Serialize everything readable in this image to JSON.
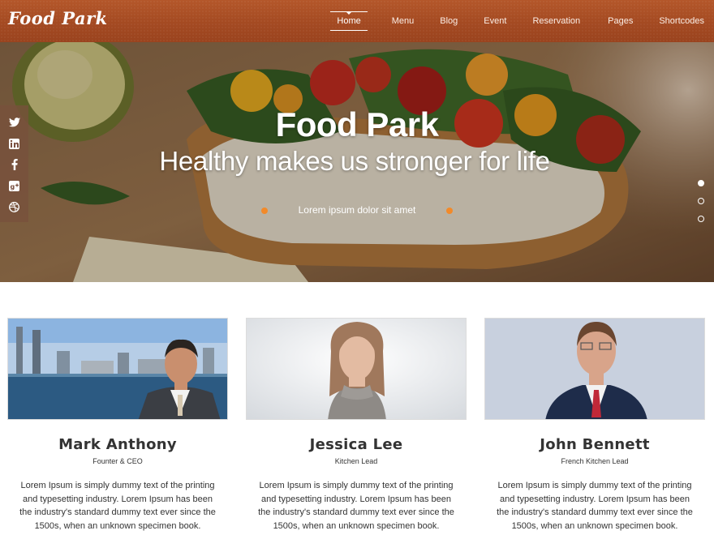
{
  "header": {
    "logo": "Food Park",
    "nav": [
      "Home",
      "Menu",
      "Blog",
      "Event",
      "Reservation",
      "Pages",
      "Shortcodes"
    ],
    "active_nav": "Home",
    "accent_color": "#a84d24"
  },
  "hero": {
    "title": "Food Park",
    "subtitle": "Healthy makes us stronger for life",
    "caption": "Lorem ipsum dolor sit amet",
    "accent_dot_color": "#f28a2a",
    "social_icons": [
      "twitter-icon",
      "linkedin-icon",
      "facebook-icon",
      "google-plus-icon",
      "dribbble-icon"
    ],
    "slides": 3,
    "active_slide": 1
  },
  "team": [
    {
      "name": "Mark Anthony",
      "role": "Founter & CEO",
      "text": "Lorem Ipsum is simply dummy text of the printing and typesetting industry. Lorem Ipsum has been the industry's standard dummy text ever since the 1500s, when an unknown  specimen book."
    },
    {
      "name": "Jessica Lee",
      "role": "Kitchen Lead",
      "text": "Lorem Ipsum is simply dummy text of the printing and typesetting industry. Lorem Ipsum has been the industry's standard dummy text ever since the 1500s, when an unknown  specimen book."
    },
    {
      "name": "John Bennett",
      "role": "French Kitchen Lead",
      "text": "Lorem Ipsum is simply dummy text of the printing and typesetting industry. Lorem Ipsum has been the industry's standard dummy text ever since the 1500s, when an unknown  specimen book."
    }
  ]
}
